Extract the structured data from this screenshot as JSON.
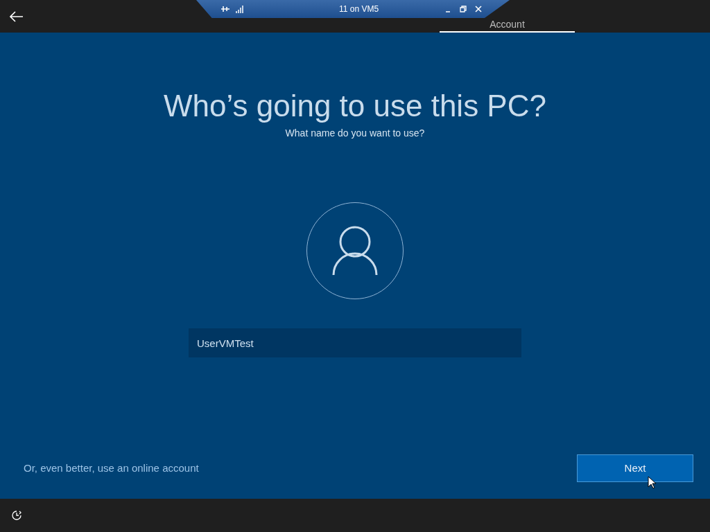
{
  "connection_bar": {
    "title": "11 on VM5"
  },
  "tabs": [
    {
      "label": "Account",
      "selected": true
    }
  ],
  "heading": "Who’s going to use this PC?",
  "subheading": "What name do you want to use?",
  "name_field": {
    "value": "UserVMTest"
  },
  "online_account_link": "Or, even better, use an online account",
  "next_button": "Next"
}
